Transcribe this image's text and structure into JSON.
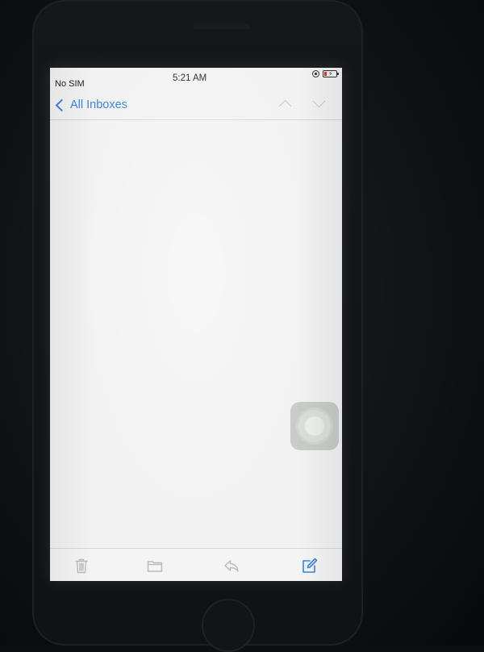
{
  "status_bar": {
    "carrier": "No SIM",
    "time": "5:21 AM",
    "battery_color": "#d9322b"
  },
  "nav": {
    "back_label": "All Inboxes",
    "accent_color": "#3b86d8",
    "up_icon": "chevron-up-icon",
    "down_icon": "chevron-down-icon"
  },
  "toolbar": {
    "items": [
      {
        "icon": "trash-icon"
      },
      {
        "icon": "folder-icon"
      },
      {
        "icon": "reply-icon"
      },
      {
        "icon": "compose-icon"
      }
    ]
  }
}
